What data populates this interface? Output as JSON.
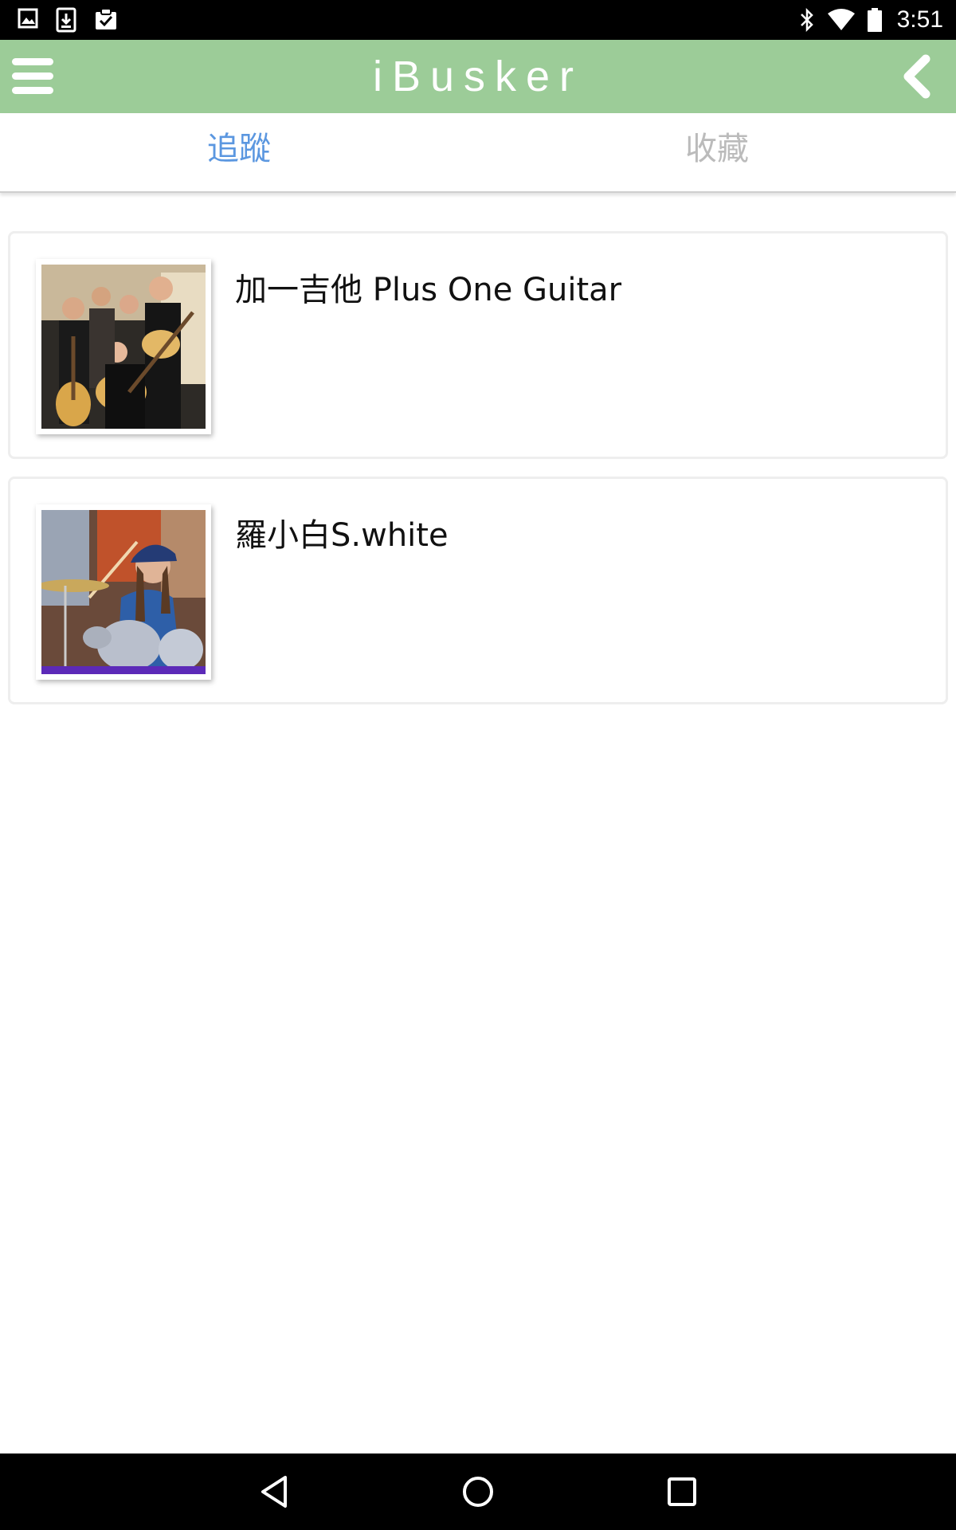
{
  "status_bar": {
    "time": "3:51",
    "left_icons": [
      "image-icon",
      "download-icon",
      "clipboard-check-icon"
    ],
    "right_icons": [
      "bluetooth-icon",
      "wifi-icon",
      "battery-icon"
    ]
  },
  "app_bar": {
    "title": "iBusker",
    "menu_icon": "menu-icon",
    "back_icon": "chevron-left-icon",
    "background": "#9ccc98"
  },
  "tabs": [
    {
      "label": "追蹤",
      "active": true
    },
    {
      "label": "收藏",
      "active": false
    }
  ],
  "accent_color": "#5b97e0",
  "items": [
    {
      "title": "加一吉他 Plus One Guitar",
      "thumbnail": "guitar-group-photo"
    },
    {
      "title": "羅小白S.white",
      "thumbnail": "drummer-photo"
    }
  ],
  "nav_bar": {
    "icons": [
      "back-triangle-icon",
      "home-circle-icon",
      "recents-square-icon"
    ]
  }
}
